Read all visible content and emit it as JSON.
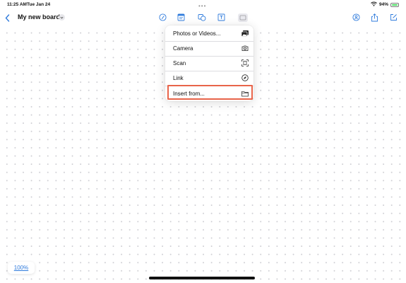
{
  "status_bar": {
    "time": "11:25 AM",
    "date": "Tue Jan 24",
    "battery_percent": "94%",
    "battery_level": 0.94,
    "multitask_dots": "•••"
  },
  "toolbar": {
    "board_title": "My new board",
    "accent_color": "#2f7bdc"
  },
  "insert_menu": {
    "items": [
      {
        "label": "Photos or Videos...",
        "icon": "photos-icon"
      },
      {
        "label": "Camera",
        "icon": "camera-icon"
      },
      {
        "label": "Scan",
        "icon": "scan-icon"
      },
      {
        "label": "Link",
        "icon": "compass-link-icon"
      },
      {
        "label": "Insert from...",
        "icon": "folder-icon"
      }
    ],
    "highlight_color": "#e8644a"
  },
  "zoom": {
    "level": "100%"
  }
}
